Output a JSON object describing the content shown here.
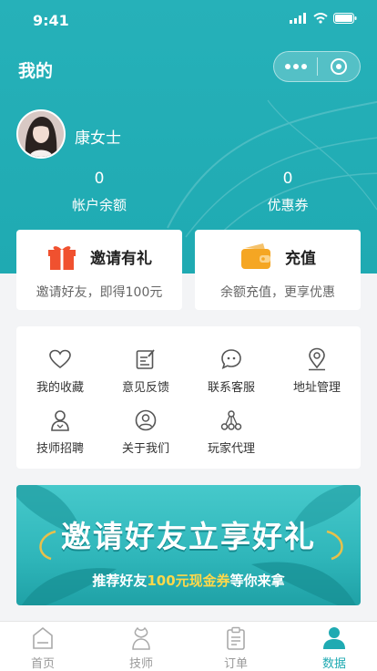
{
  "status_bar": {
    "time": "9:41"
  },
  "nav": {
    "title": "我的"
  },
  "profile": {
    "name": "康女士"
  },
  "stats": [
    {
      "value": "0",
      "label": "帐户余额"
    },
    {
      "value": "0",
      "label": "优惠券"
    }
  ],
  "cards": {
    "invite": {
      "title": "邀请有礼",
      "subtitle": "邀请好友，即得100元"
    },
    "recharge": {
      "title": "充值",
      "subtitle": "余额充值，更享优惠"
    }
  },
  "menu": [
    {
      "label": "我的收藏",
      "icon": "heart-icon"
    },
    {
      "label": "意见反馈",
      "icon": "edit-note-icon"
    },
    {
      "label": "联系客服",
      "icon": "chat-bubble-icon"
    },
    {
      "label": "地址管理",
      "icon": "location-pin-icon"
    },
    {
      "label": "技师招聘",
      "icon": "technician-icon"
    },
    {
      "label": "关于我们",
      "icon": "user-circle-icon"
    },
    {
      "label": "玩家代理",
      "icon": "network-icon"
    }
  ],
  "banner": {
    "headline": "邀请好友立享好礼",
    "sub_prefix": "推荐好友",
    "sub_highlight": "100元现金券",
    "sub_suffix": "等你来拿"
  },
  "tabbar": [
    {
      "label": "首页",
      "icon": "home-icon",
      "active": false
    },
    {
      "label": "技师",
      "icon": "technician-icon",
      "active": false
    },
    {
      "label": "订单",
      "icon": "clipboard-icon",
      "active": false
    },
    {
      "label": "数据",
      "icon": "person-icon",
      "active": true
    }
  ],
  "colors": {
    "primary": "#1faab2",
    "header_bg": "#26b1b9",
    "gift_red": "#f0512f",
    "wallet_orange": "#f5a623",
    "highlight_yellow": "#ffd84a",
    "tab_inactive": "#999999"
  }
}
